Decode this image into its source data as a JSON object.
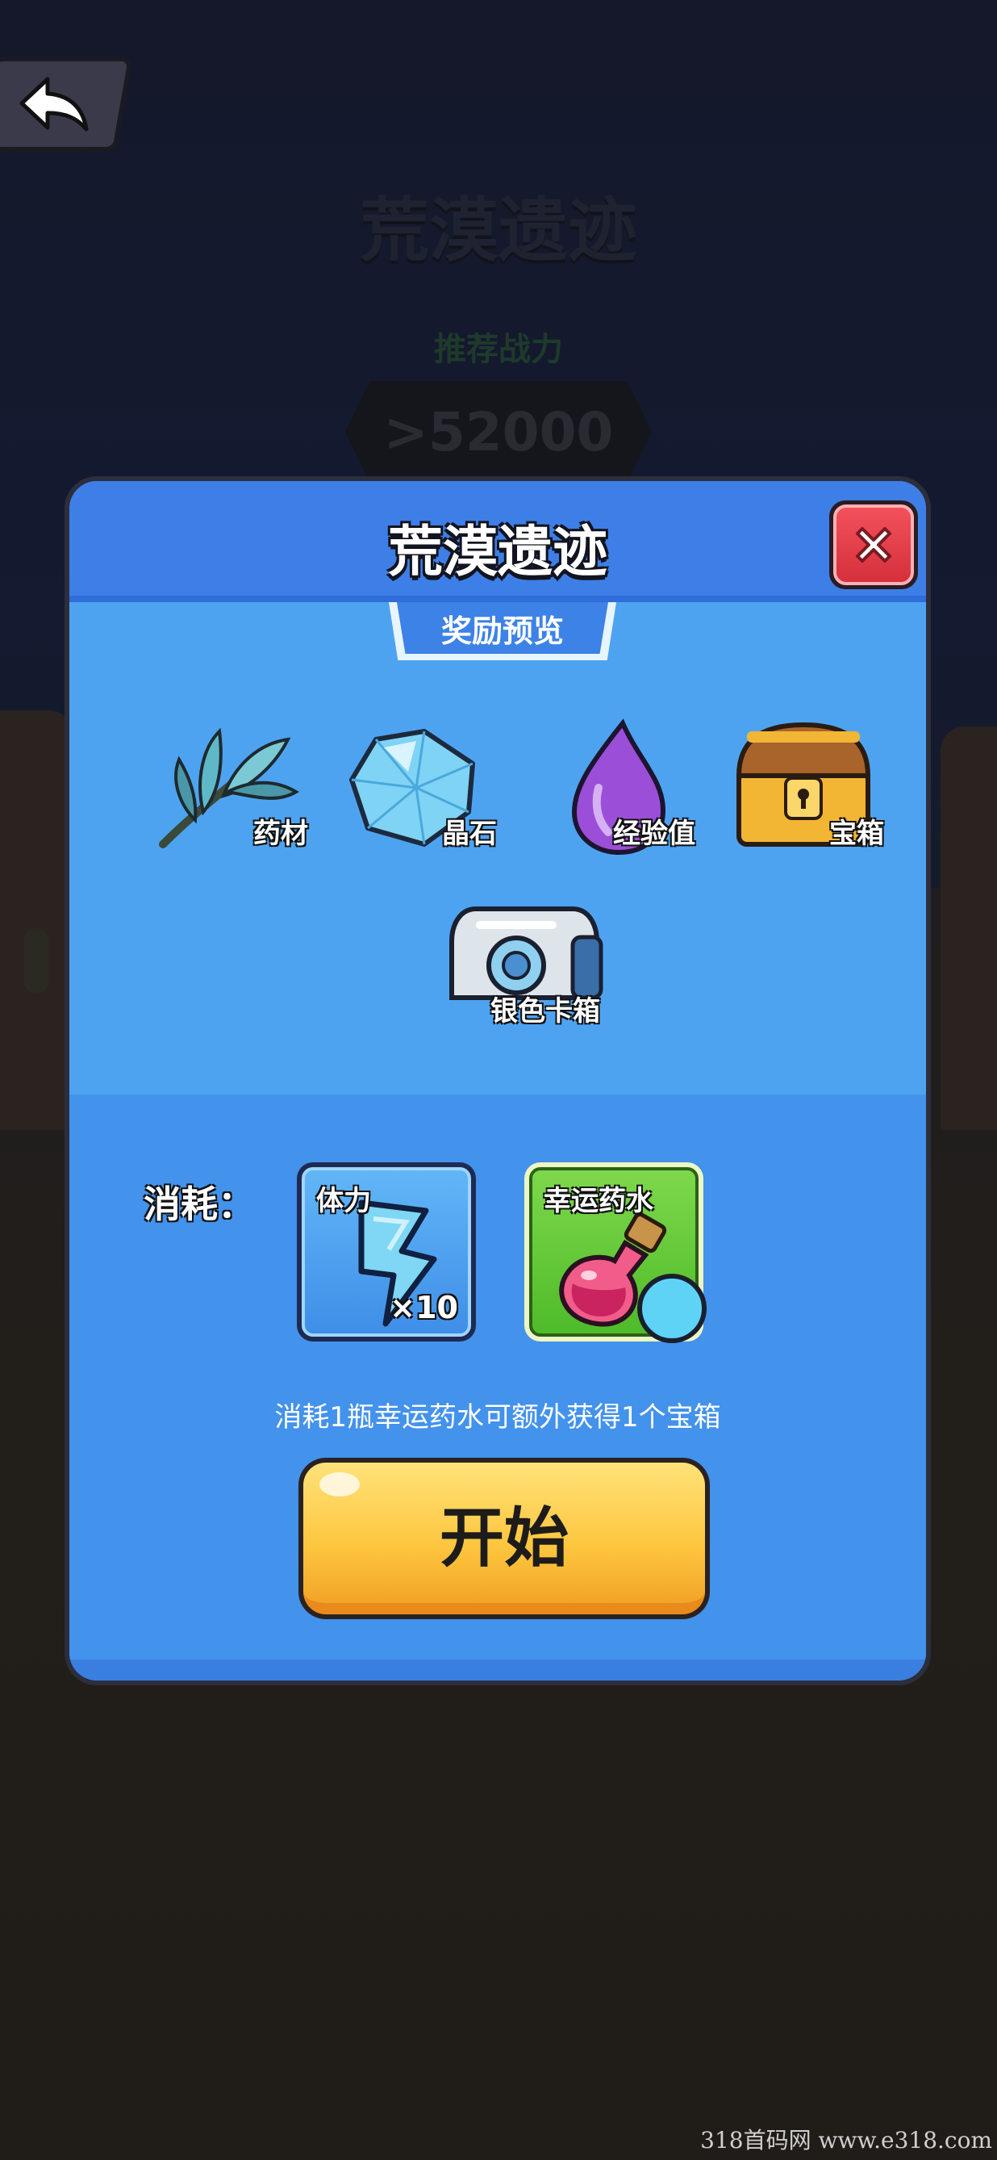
{
  "background": {
    "title": "荒漠遗迹",
    "power_label": "推荐战力",
    "power_value": ">52000"
  },
  "dialog": {
    "title": "荒漠遗迹",
    "reward_tab": "奖励预览",
    "rewards": [
      {
        "label": "药材",
        "icon": "herb-icon"
      },
      {
        "label": "晶石",
        "icon": "crystal-icon"
      },
      {
        "label": "经验值",
        "icon": "exp-drop-icon"
      },
      {
        "label": "宝箱",
        "icon": "treasure-chest-icon"
      },
      {
        "label": "银色卡箱",
        "icon": "silver-card-box-icon"
      }
    ],
    "cost_label": "消耗：",
    "costs": [
      {
        "name": "体力",
        "count": "×10",
        "icon": "lightning-icon"
      },
      {
        "name": "幸运药水",
        "icon": "potion-icon"
      }
    ],
    "cost_note": "消耗1瓶幸运药水可额外获得1个宝箱",
    "start_label": "开始"
  },
  "watermark": "318首码网 www.e318.com",
  "colors": {
    "dialog_blue": "#3a7fe0",
    "reward_blue": "#4ea3f1",
    "start_yellow": "#fdc63e",
    "close_red": "#e03d48",
    "potion_green": "#5cc433"
  }
}
